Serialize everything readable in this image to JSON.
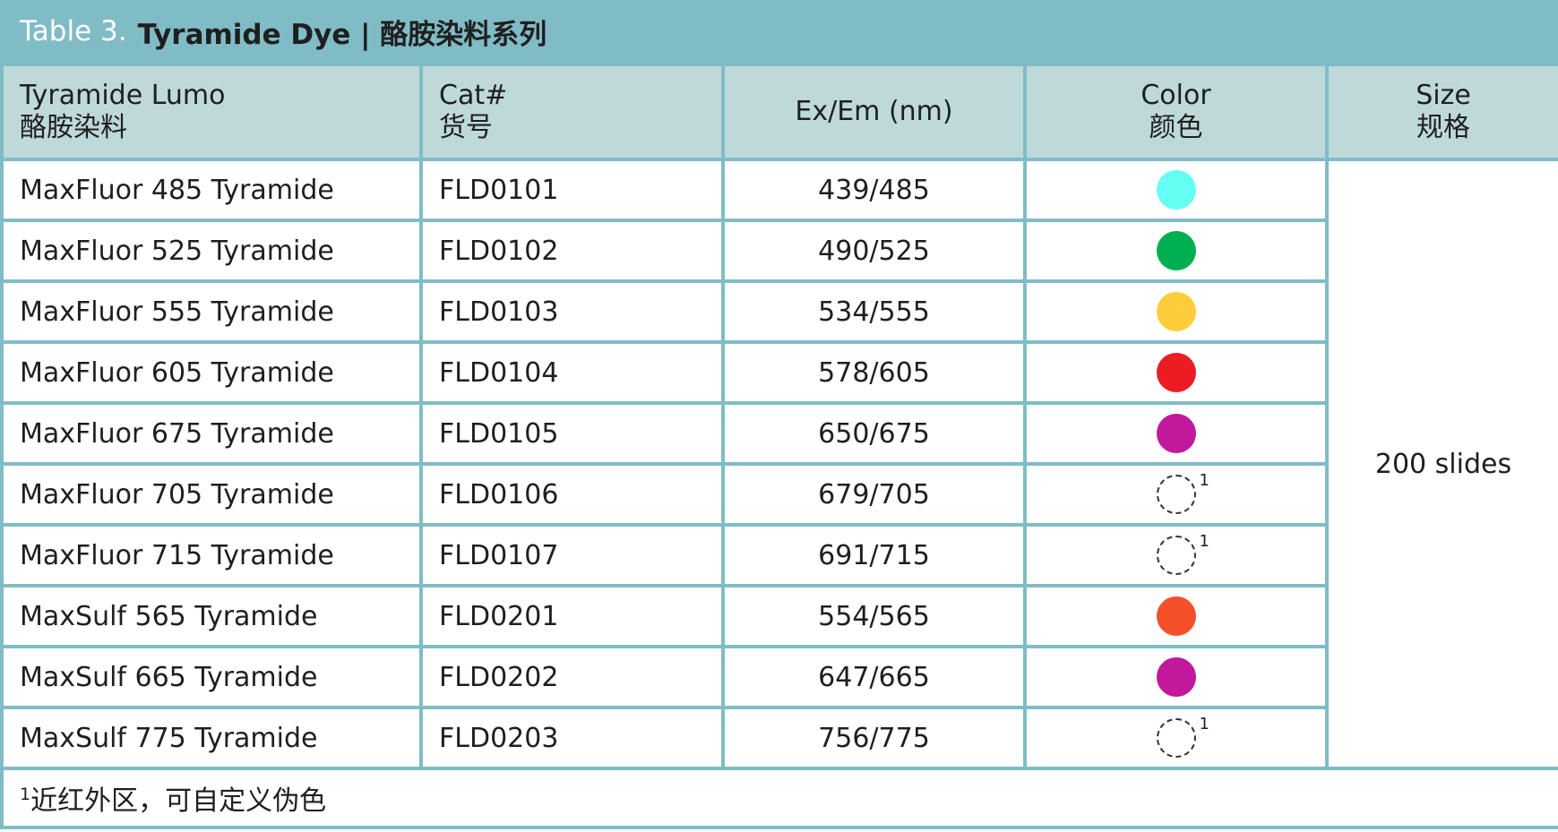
{
  "title": {
    "label": "Table 3.",
    "main": "Tyramide Dye | 酪胺染料系列"
  },
  "headers": [
    {
      "en": "Tyramide Lumo",
      "zh": "酪胺染料"
    },
    {
      "en": "Cat#",
      "zh": "货号"
    },
    {
      "en": "Ex/Em (nm)",
      "zh": ""
    },
    {
      "en": "Color",
      "zh": "颜色"
    },
    {
      "en": "Size",
      "zh": "规格"
    }
  ],
  "rows": [
    {
      "name": "MaxFluor 485 Tyramide",
      "cat": "FLD0101",
      "exem": "439/485",
      "color": "#66FFF4",
      "note": ""
    },
    {
      "name": "MaxFluor 525 Tyramide",
      "cat": "FLD0102",
      "exem": "490/525",
      "color": "#00B050",
      "note": ""
    },
    {
      "name": "MaxFluor 555 Tyramide",
      "cat": "FLD0103",
      "exem": "534/555",
      "color": "#FFCC3C",
      "note": ""
    },
    {
      "name": "MaxFluor 605 Tyramide",
      "cat": "FLD0104",
      "exem": "578/605",
      "color": "#ED1C24",
      "note": ""
    },
    {
      "name": "MaxFluor 675 Tyramide",
      "cat": "FLD0105",
      "exem": "650/675",
      "color": "#C2189B",
      "note": ""
    },
    {
      "name": "MaxFluor 705 Tyramide",
      "cat": "FLD0106",
      "exem": "679/705",
      "color": "",
      "note": "1"
    },
    {
      "name": "MaxFluor 715 Tyramide",
      "cat": "FLD0107",
      "exem": "691/715",
      "color": "",
      "note": "1"
    },
    {
      "name": "MaxSulf 565 Tyramide",
      "cat": "FLD0201",
      "exem": "554/565",
      "color": "#F4502A",
      "note": ""
    },
    {
      "name": "MaxSulf 665 Tyramide",
      "cat": "FLD0202",
      "exem": "647/665",
      "color": "#C2189B",
      "note": ""
    },
    {
      "name": "MaxSulf 775 Tyramide",
      "cat": "FLD0203",
      "exem": "756/775",
      "color": "",
      "note": "1"
    }
  ],
  "size_value": "200 slides",
  "footnote": {
    "mark": "1",
    "text": "近红外区，可自定义伪色"
  }
}
